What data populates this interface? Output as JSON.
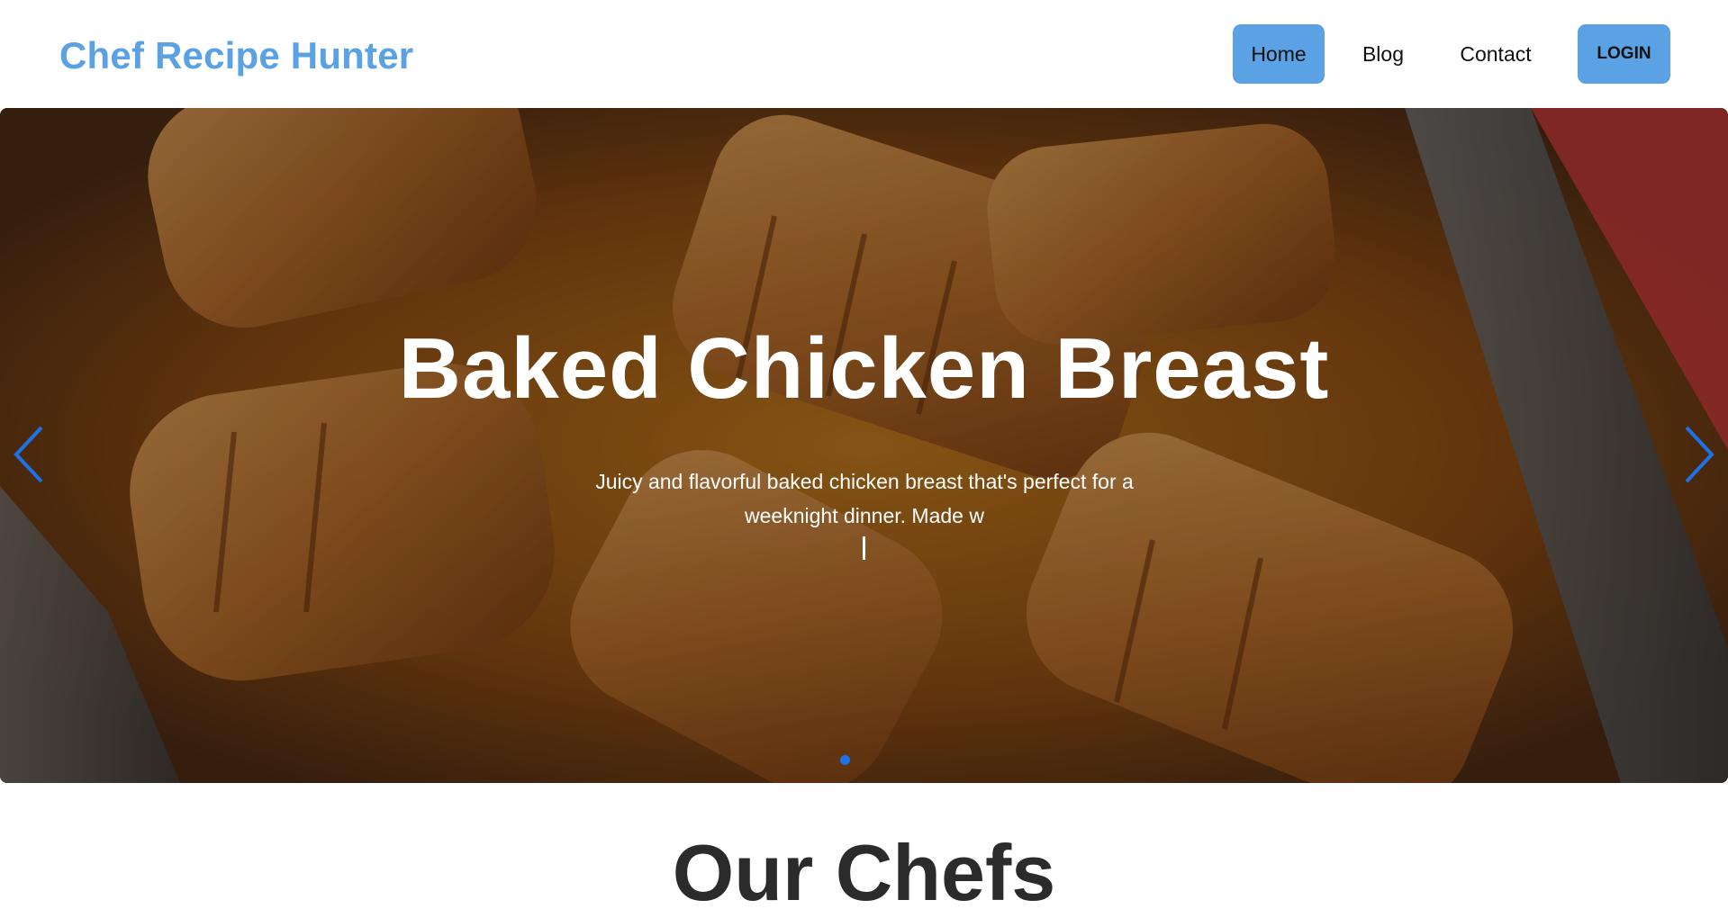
{
  "brand": {
    "title": "Chef Recipe Hunter",
    "color": "#5aa2e4"
  },
  "nav": {
    "items": [
      {
        "label": "Home",
        "active": true
      },
      {
        "label": "Blog",
        "active": false
      },
      {
        "label": "Contact",
        "active": false
      }
    ],
    "login_label": "LOGIN",
    "accent": "#5aa2e4"
  },
  "hero": {
    "title": "Baked Chicken Breast",
    "description": "Juicy and flavorful baked chicken breast that's perfect for a weeknight dinner. Made w",
    "cursor": "|",
    "prev_icon": "chevron-left-icon",
    "next_icon": "chevron-right-icon",
    "indicator_color": "#1a73e8",
    "active_slide": 1
  },
  "section": {
    "title": "Our Chefs"
  }
}
